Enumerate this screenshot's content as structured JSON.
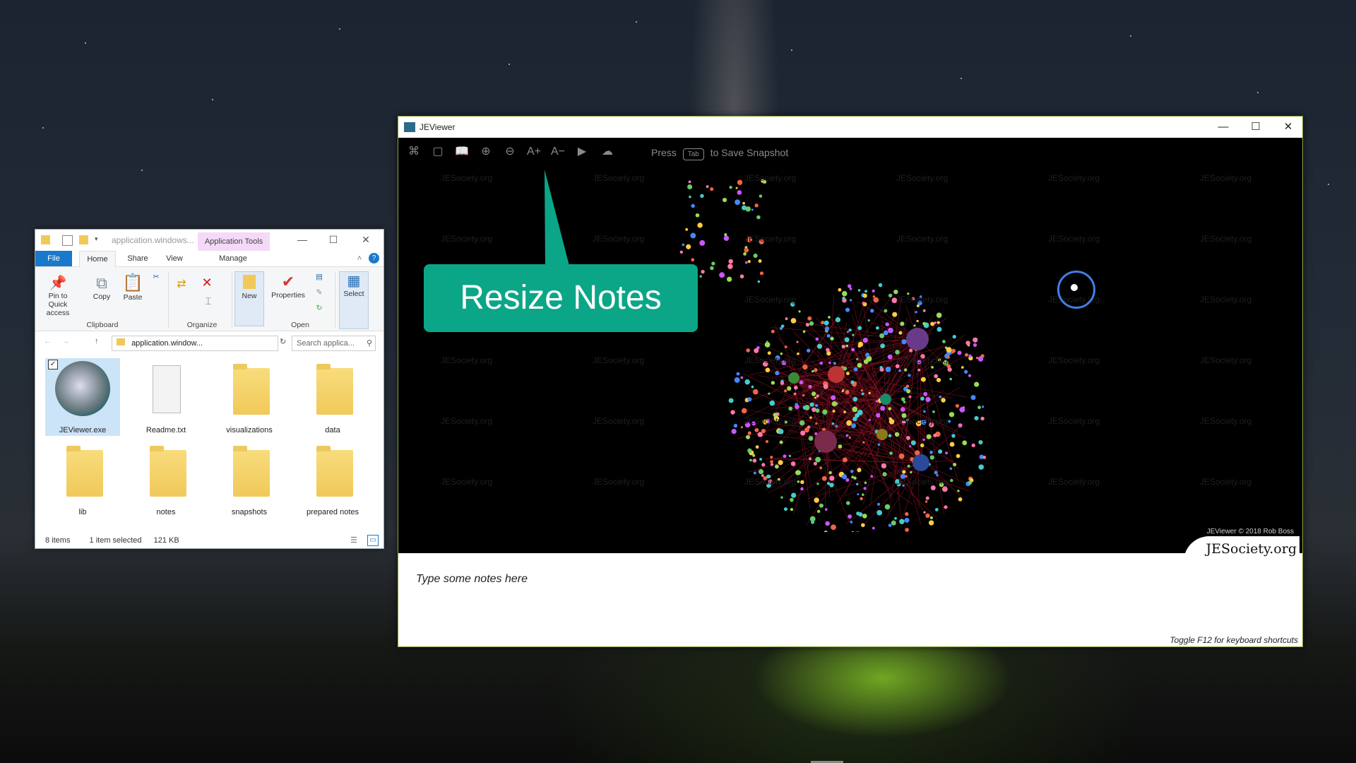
{
  "desktop": {
    "background": "night sky wallpaper with tent"
  },
  "explorer": {
    "path_title": "application.windows...",
    "context_tab": "Application Tools",
    "tabs": [
      "File",
      "Home",
      "Share",
      "View",
      "Manage"
    ],
    "ribbon": {
      "pin": "Pin to Quick access",
      "copy": "Copy",
      "paste": "Paste",
      "clipboard_group": "Clipboard",
      "organize_group": "Organize",
      "new": "New",
      "properties": "Properties",
      "open_group": "Open",
      "select": "Select"
    },
    "address": "application.window...",
    "search_placeholder": "Search applica...",
    "files": [
      "JEViewer.exe",
      "Readme.txt",
      "visualizations",
      "data",
      "lib",
      "notes",
      "snapshots",
      "prepared notes"
    ],
    "status": {
      "items": "8 items",
      "selected": "1 item selected",
      "size": "121 KB"
    }
  },
  "jeviewer": {
    "title": "JEViewer",
    "press": "Press",
    "tab_key": "Tab",
    "save_snapshot": "to Save  Snapshot",
    "watermark": "JESociety.org",
    "credit": "JEViewer © 2018 Rob Boss",
    "logo": "JESociety.org",
    "notes_placeholder": "Type some notes here",
    "shortcuts_hint": "Toggle F12 for keyboard shortcuts"
  },
  "callout": {
    "text": "Resize Notes",
    "color": "#0ba687"
  },
  "colors": {
    "accent_blue": "#1979ca",
    "app_tools": "#f4d9f8",
    "window_border": "#8ca53a"
  }
}
